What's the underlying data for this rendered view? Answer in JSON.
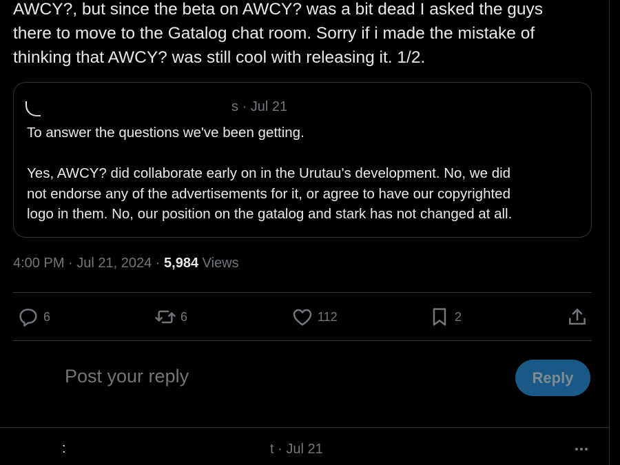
{
  "tweet": {
    "text": "AWCY?,  but since the beta on AWCY? was a bit dead I asked the guys\nthere to move to the Gatalog chat room. Sorry if i made the mistake of\nthinking that AWCY? was still cool with releasing it. 1/2."
  },
  "quote": {
    "meta": "s · Jul 21",
    "body": "To answer the questions we've been getting.\n\nYes, AWCY? did collaborate early on in the Urutau's development. No, we did\nnot endorse any of the advertisements for it, or agree to have our copyrighted\nlogo in them. No, our position on the gatalog and stark has not changed at all."
  },
  "meta": {
    "time_date": "4:00 PM · Jul 21, 2024 · ",
    "views_count": "5,984",
    "views_label": " Views"
  },
  "actions": {
    "replies": "6",
    "reposts": "6",
    "likes": "112",
    "bookmarks": "2"
  },
  "reply_box": {
    "placeholder": "Post your reply",
    "button_label": "Reply"
  },
  "next_tweet": {
    "marker": ":",
    "meta": "t · Jul 21"
  },
  "colors": {
    "background": "#000000",
    "text": "#e7e9ea",
    "muted": "#71767b",
    "border": "#2f3336",
    "reply_button_disabled": "#1a5885"
  },
  "icons": [
    "reply-icon",
    "repost-icon",
    "like-icon",
    "bookmark-icon",
    "share-icon",
    "more-icon"
  ]
}
